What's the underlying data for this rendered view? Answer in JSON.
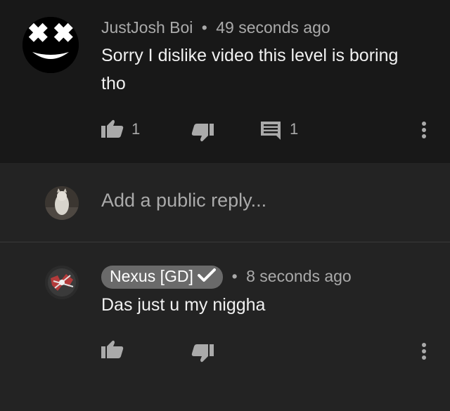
{
  "comment": {
    "author": "JustJosh Boi",
    "separator": "•",
    "timestamp": "49 seconds ago",
    "text": "Sorry I dislike video this level is boring tho",
    "like_count": "1",
    "reply_count": "1"
  },
  "reply_input": {
    "placeholder": "Add a public reply..."
  },
  "reply": {
    "author": "Nexus [GD]",
    "separator": "•",
    "timestamp": "8 seconds ago",
    "text": "Das just u my niggha"
  },
  "icons": {
    "like": "thumbs-up-icon",
    "dislike": "thumbs-down-icon",
    "reply": "comment-icon",
    "more": "more-vertical-icon",
    "verified": "checkmark-icon"
  },
  "colors": {
    "background": "#181818",
    "reply_background": "#232323",
    "meta_text": "#aaaaaa",
    "author_chip": "#6a6a6a"
  }
}
